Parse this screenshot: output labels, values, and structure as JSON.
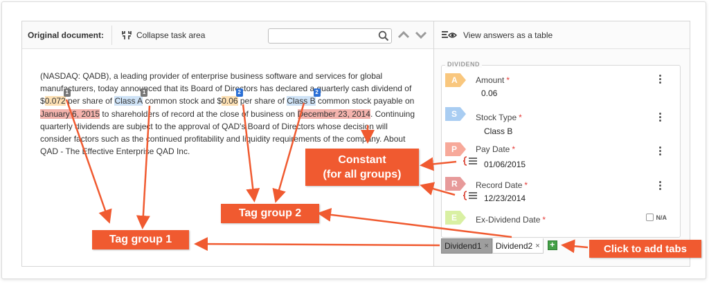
{
  "toolbar": {
    "original_label": "Original document:",
    "collapse_label": "Collapse task area",
    "search_placeholder": ""
  },
  "document": {
    "t1": "(NASDAQ: QADB), a leading provider of enterprise business software and services for global manufacturers, today announced that its Board of Directors has declared a quarterly cash dividend of $",
    "amount1": "0.072",
    "t2": " per share of ",
    "classA": "Class A",
    "t3": " common stock and $",
    "amount2": "0.06",
    "t4": " per share of ",
    "classB": "Class B",
    "t5": " common stock payable on ",
    "paydate": "January 6, 2015",
    "t6": " to shareholders of record at the close of business on ",
    "recorddate": "December 23, 2014",
    "t7": ". Continuing quarterly dividends are subject to the approval of QAD's Board of Directors whose decision will consider factors such as the continued profitability and liquidity requirements of the company. About QAD - The Effective Enterprise QAD Inc.",
    "group1_badge": "1",
    "group2_badge": "2"
  },
  "right_panel": {
    "view_table_label": "View answers as a table",
    "section_title": "DIVIDEND",
    "fields": [
      {
        "letter": "A",
        "name": "Amount",
        "value": "0.06",
        "color": "#f9c77e"
      },
      {
        "letter": "S",
        "name": "Stock Type",
        "value": "Class B",
        "color": "#a9cdf2"
      },
      {
        "letter": "P",
        "name": "Pay Date",
        "value": "01/06/2015",
        "color": "#f7a99a"
      },
      {
        "letter": "R",
        "name": "Record Date",
        "value": "12/23/2014",
        "color": "#e79a9a"
      },
      {
        "letter": "E",
        "name": "Ex-Dividend Date",
        "value": "",
        "color": "#d9f0a3"
      }
    ],
    "required_mark": "*",
    "na_label": "N/A",
    "tabs": [
      "Dividend1",
      "Dividend2"
    ],
    "tab_close": "×",
    "add_tab_symbol": "+"
  },
  "callouts": {
    "constant_line1": "Constant",
    "constant_line2": "(for all groups)",
    "tag_group_2": "Tag group 2",
    "tag_group_1": "Tag group 1",
    "add_tabs": "Click to add tabs"
  },
  "colors": {
    "callout": "#f05a30",
    "highlight_amount": "#fde0b3",
    "highlight_class": "#cfe3f7",
    "highlight_date": "#f4b3ad"
  }
}
